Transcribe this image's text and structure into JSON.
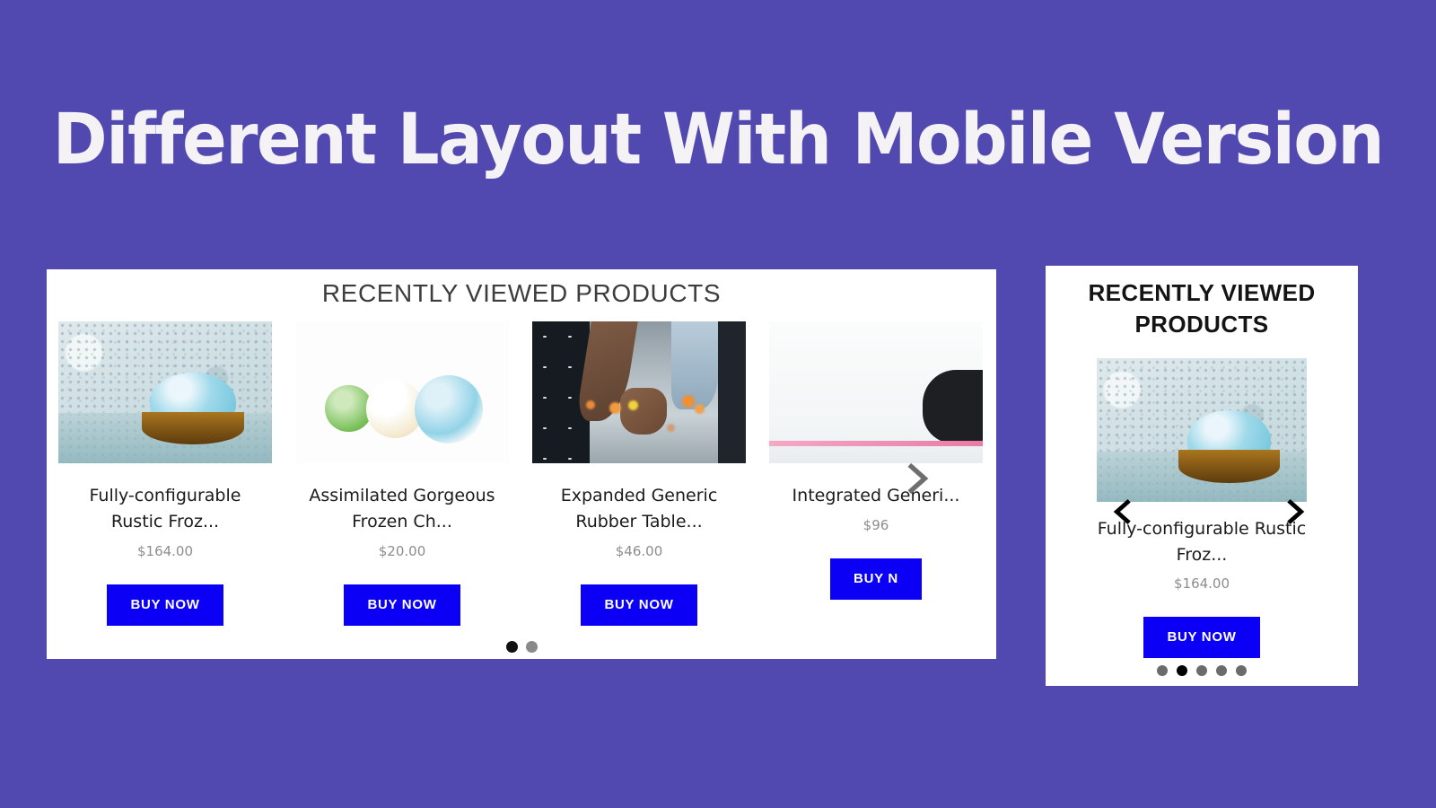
{
  "page": {
    "title": "Different Layout With Mobile Version",
    "background_color": "#5148b0",
    "title_color": "#f5f2f6"
  },
  "desktop_carousel": {
    "heading": "RECENTLY VIEWED PRODUCTS",
    "next_arrow_icon": "chevron-right-icon",
    "accent_button_color": "#0b00f5",
    "items": [
      {
        "name": "Fully-configurable Rustic Froz...",
        "price": "$164.00",
        "buy_label": "BUY NOW",
        "image": "bath-bomb-on-tiled-ledge"
      },
      {
        "name": "Assimilated Gorgeous Frozen Ch...",
        "price": "$20.00",
        "buy_label": "BUY NOW",
        "image": "three-bath-bombs"
      },
      {
        "name": "Expanded Generic Rubber Table...",
        "price": "$46.00",
        "buy_label": "BUY NOW",
        "image": "couple-holding-hands"
      },
      {
        "name": "Integrated Generi...",
        "price": "$96",
        "buy_label": "BUY N",
        "image": "yoga-mat-scene"
      }
    ],
    "dots": [
      {
        "active": true
      },
      {
        "active": false
      }
    ]
  },
  "mobile_carousel": {
    "heading": "RECENTLY VIEWED PRODUCTS",
    "prev_arrow_icon": "chevron-left-icon",
    "next_arrow_icon": "chevron-right-icon",
    "item": {
      "name": "Fully-configurable Rustic Froz...",
      "price": "$164.00",
      "buy_label": "BUY NOW",
      "image": "bath-bomb-on-tiled-ledge"
    },
    "dots": [
      {
        "active": false
      },
      {
        "active": true
      },
      {
        "active": false
      },
      {
        "active": false
      },
      {
        "active": false
      }
    ]
  }
}
